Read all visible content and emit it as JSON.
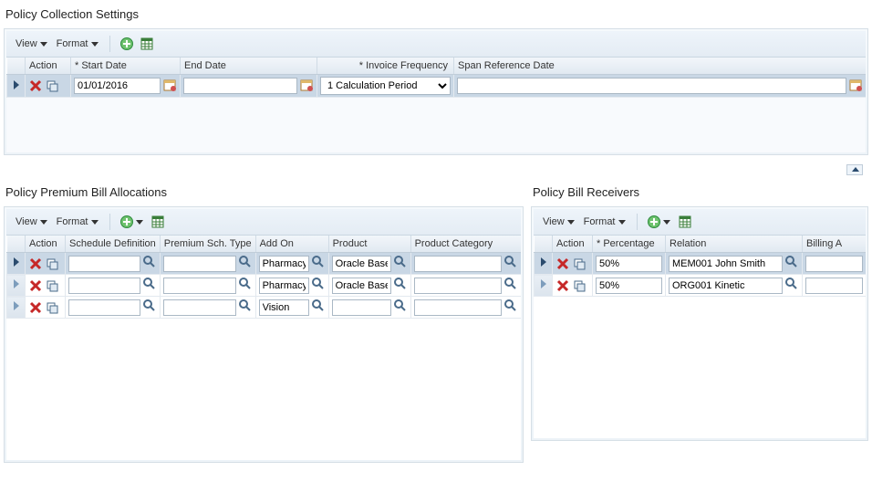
{
  "sections": {
    "collection_title": "Policy Collection Settings",
    "allocations_title": "Policy Premium Bill Allocations",
    "receivers_title": "Policy Bill Receivers"
  },
  "menus": {
    "view": "View",
    "format": "Format"
  },
  "icons": {
    "add": "plus",
    "export": "spreadsheet",
    "delete": "x-red",
    "copy": "copy",
    "calendar": "calendar",
    "lookup": "magnifier",
    "dropdown": "triangle"
  },
  "collection": {
    "headers": {
      "action": "Action",
      "start_date": "* Start Date",
      "end_date": "End Date",
      "invoice_freq": "* Invoice Frequency",
      "span_date": "Span Reference Date"
    },
    "row": {
      "start_date": "01/01/2016",
      "end_date": "",
      "invoice_freq_selected": "1 Calculation Period",
      "span_date": ""
    }
  },
  "allocations": {
    "headers": {
      "action": "Action",
      "schedule_def": "Schedule Definition",
      "premium_type": "Premium Sch. Type",
      "add_on": "Add On",
      "product": "Product",
      "product_cat": "Product Category"
    },
    "rows": [
      {
        "selected": true,
        "schedule_def": "",
        "premium_type": "",
        "add_on": "Pharmacy",
        "product": "Oracle Base",
        "product_cat": ""
      },
      {
        "selected": false,
        "schedule_def": "",
        "premium_type": "",
        "add_on": "Pharmacy",
        "product": "Oracle Base",
        "product_cat": ""
      },
      {
        "selected": false,
        "schedule_def": "",
        "premium_type": "",
        "add_on": "Vision",
        "product": "",
        "product_cat": ""
      }
    ]
  },
  "receivers": {
    "headers": {
      "action": "Action",
      "percentage": "* Percentage",
      "relation": "Relation",
      "billing_a": "Billing A"
    },
    "rows": [
      {
        "selected": true,
        "percentage": "50%",
        "relation": "MEM001 John Smith",
        "billing_a": ""
      },
      {
        "selected": false,
        "percentage": "50%",
        "relation": "ORG001 Kinetic",
        "billing_a": ""
      }
    ]
  }
}
